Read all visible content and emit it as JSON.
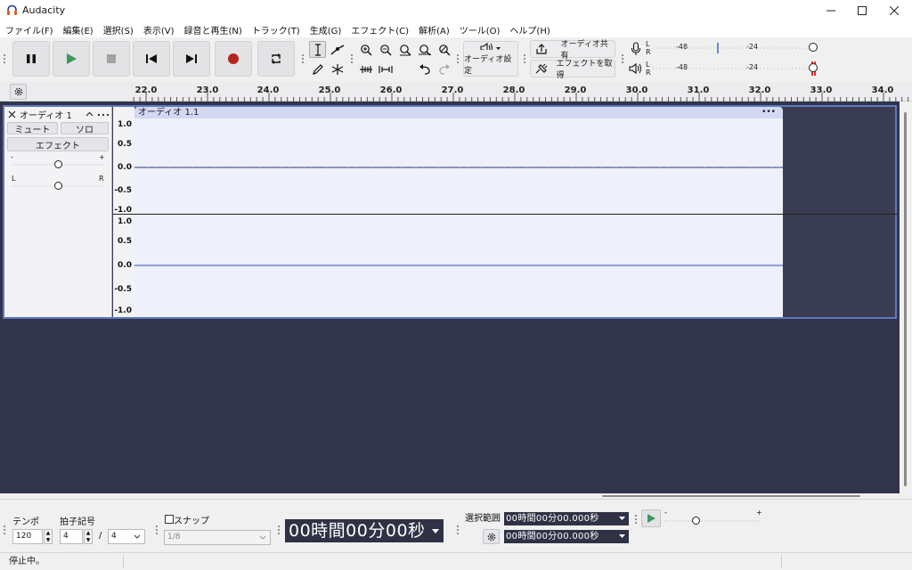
{
  "app": {
    "title": "Audacity"
  },
  "menu": [
    "ファイル(F)",
    "編集(E)",
    "選択(S)",
    "表示(V)",
    "録音と再生(N)",
    "トラック(T)",
    "生成(G)",
    "エフェクト(C)",
    "解析(A)",
    "ツール(O)",
    "ヘルプ(H)"
  ],
  "toolbar": {
    "audio_setup_label": "オーディオ設定",
    "share_audio_label": "オーディオ共有",
    "get_effects_label": "エフェクトを取得",
    "meter_record_scale": [
      "-48",
      "-24"
    ],
    "meter_play_scale": [
      "-48",
      "-24"
    ],
    "meter_letters": [
      "L",
      "R"
    ]
  },
  "ruler": {
    "ticks": [
      "22.0",
      "23.0",
      "24.0",
      "25.0",
      "26.0",
      "27.0",
      "28.0",
      "29.0",
      "30.0",
      "31.0",
      "32.0",
      "33.0",
      "34.0"
    ]
  },
  "track": {
    "name": "オーディオ 1",
    "mute_label": "ミュート",
    "solo_label": "ソロ",
    "effects_label": "エフェクト",
    "gain_minus": "-",
    "gain_plus": "+",
    "pan_left": "L",
    "pan_right": "R",
    "clip_name": "オーディオ 1.1",
    "clip_menu": "•••",
    "scale_top": [
      "1.0",
      "0.5",
      "0.0",
      "-0.5",
      "-1.0"
    ],
    "scale_bottom": [
      "1.0",
      "0.5",
      "0.0",
      "-0.5",
      "-1.0"
    ]
  },
  "bottom": {
    "tempo_label": "テンポ",
    "tempo_value": "120",
    "time_signature_label": "拍子記号",
    "time_sig_upper": "4",
    "time_sig_slash": "/",
    "time_sig_lower": "4",
    "snap_label": "スナップ",
    "snap_value": "1/8",
    "timer": "00時間00分00秒",
    "selection_label": "選択範囲",
    "selection_start": "00時間00分00.000秒",
    "selection_end": "00時間00分00.000秒",
    "play_speed_minus": "-",
    "play_speed_plus": "+"
  },
  "status": {
    "text": "停止中。"
  },
  "colors": {
    "accent_blue": "#5e79c0",
    "track_bg": "#31344a",
    "record_red": "#b3261e",
    "play_green": "#3a9a5b"
  }
}
